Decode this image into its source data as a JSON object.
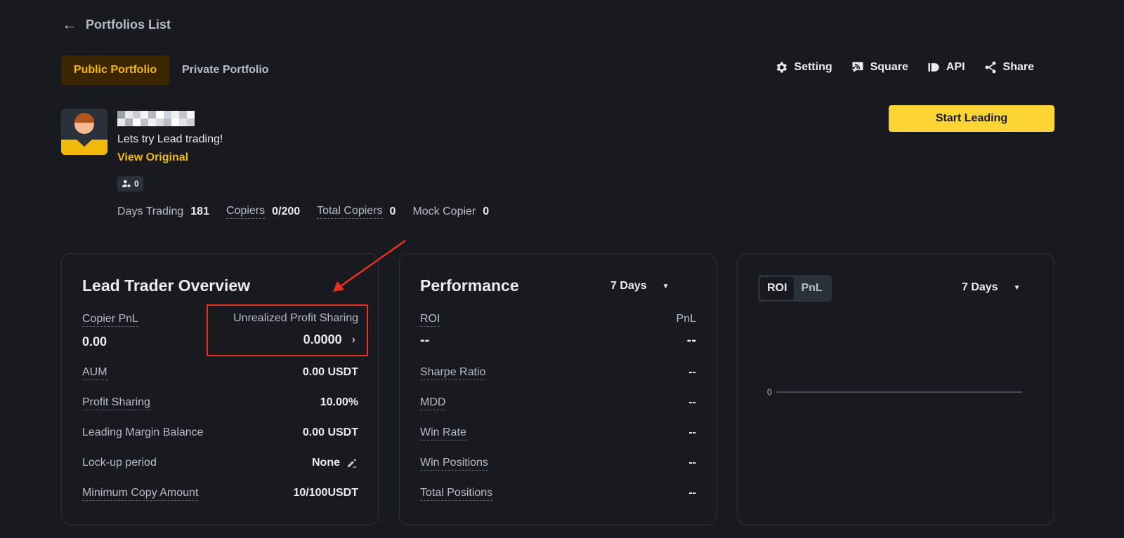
{
  "nav": {
    "back_label": "Portfolios List"
  },
  "tabs": {
    "public": "Public Portfolio",
    "private": "Private Portfolio"
  },
  "actions": {
    "setting": "Setting",
    "square": "Square",
    "api": "API",
    "share": "Share"
  },
  "profile": {
    "bio": "Lets try Lead trading!",
    "view_original": "View Original",
    "badge_count": "0",
    "start_leading": "Start Leading"
  },
  "stats": {
    "days_trading_label": "Days Trading",
    "days_trading_value": "181",
    "copiers_label": "Copiers",
    "copiers_value": "0/200",
    "total_copiers_label": "Total Copiers",
    "total_copiers_value": "0",
    "mock_copier_label": "Mock Copier",
    "mock_copier_value": "0"
  },
  "overview": {
    "title": "Lead Trader Overview",
    "copier_pnl_label": "Copier PnL",
    "copier_pnl_value": "0.00",
    "ups_label": "Unrealized Profit Sharing",
    "ups_value": "0.0000",
    "aum_label": "AUM",
    "aum_value": "0.00 USDT",
    "profit_sharing_label": "Profit Sharing",
    "profit_sharing_value": "10.00%",
    "margin_label": "Leading Margin Balance",
    "margin_value": "0.00 USDT",
    "lockup_label": "Lock-up period",
    "lockup_value": "None",
    "min_copy_label": "Minimum Copy Amount",
    "min_copy_value": "10/100USDT"
  },
  "performance": {
    "title": "Performance",
    "period": "7 Days",
    "roi_label": "ROI",
    "roi_value": "--",
    "pnl_label": "PnL",
    "pnl_value": "--",
    "sharpe_label": "Sharpe Ratio",
    "sharpe_value": "--",
    "mdd_label": "MDD",
    "mdd_value": "--",
    "win_rate_label": "Win Rate",
    "win_rate_value": "--",
    "win_positions_label": "Win Positions",
    "win_positions_value": "--",
    "total_positions_label": "Total Positions",
    "total_positions_value": "--"
  },
  "chart_panel": {
    "toggle_roi": "ROI",
    "toggle_pnl": "PnL",
    "period": "7 Days",
    "zero_label": "0"
  },
  "colors": {
    "accent": "#f0b90b",
    "button": "#fcd535",
    "background": "#181a20",
    "highlight": "#e8311d"
  }
}
